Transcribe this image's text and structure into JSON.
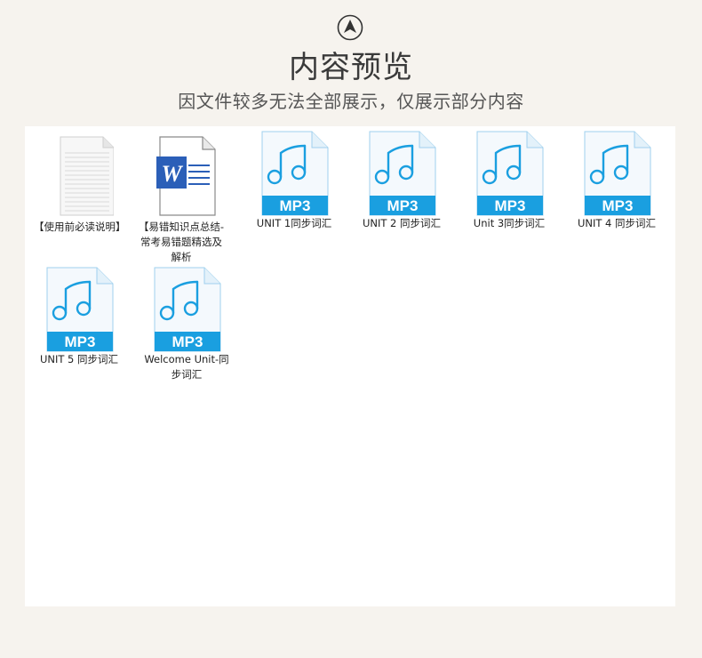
{
  "header": {
    "title": "内容预览",
    "subtitle": "因文件较多无法全部展示，仅展示部分内容",
    "up_icon": "up-arrow-circle-icon"
  },
  "files": [
    {
      "name": "【使用前必读说明】",
      "type": "txt",
      "icon": "text-document-icon"
    },
    {
      "name": "【易错知识点总结-常考易错题精选及解析",
      "type": "word",
      "icon": "word-document-icon",
      "badge": "W"
    },
    {
      "name": "UNIT 1同步词汇",
      "type": "mp3",
      "icon": "mp3-file-icon",
      "badge": "MP3"
    },
    {
      "name": "UNIT 2 同步词汇",
      "type": "mp3",
      "icon": "mp3-file-icon",
      "badge": "MP3"
    },
    {
      "name": "Unit 3同步词汇",
      "type": "mp3",
      "icon": "mp3-file-icon",
      "badge": "MP3"
    },
    {
      "name": "UNIT 4 同步词汇",
      "type": "mp3",
      "icon": "mp3-file-icon",
      "badge": "MP3"
    },
    {
      "name": "UNIT 5 同步词汇",
      "type": "mp3",
      "icon": "mp3-file-icon",
      "badge": "MP3"
    },
    {
      "name": "Welcome Unit-同步词汇",
      "type": "mp3",
      "icon": "mp3-file-icon",
      "badge": "MP3"
    }
  ],
  "colors": {
    "background": "#f6f3ee",
    "panel": "#ffffff",
    "mp3_accent": "#1a9fe0",
    "word_blue": "#2b5fb8"
  }
}
